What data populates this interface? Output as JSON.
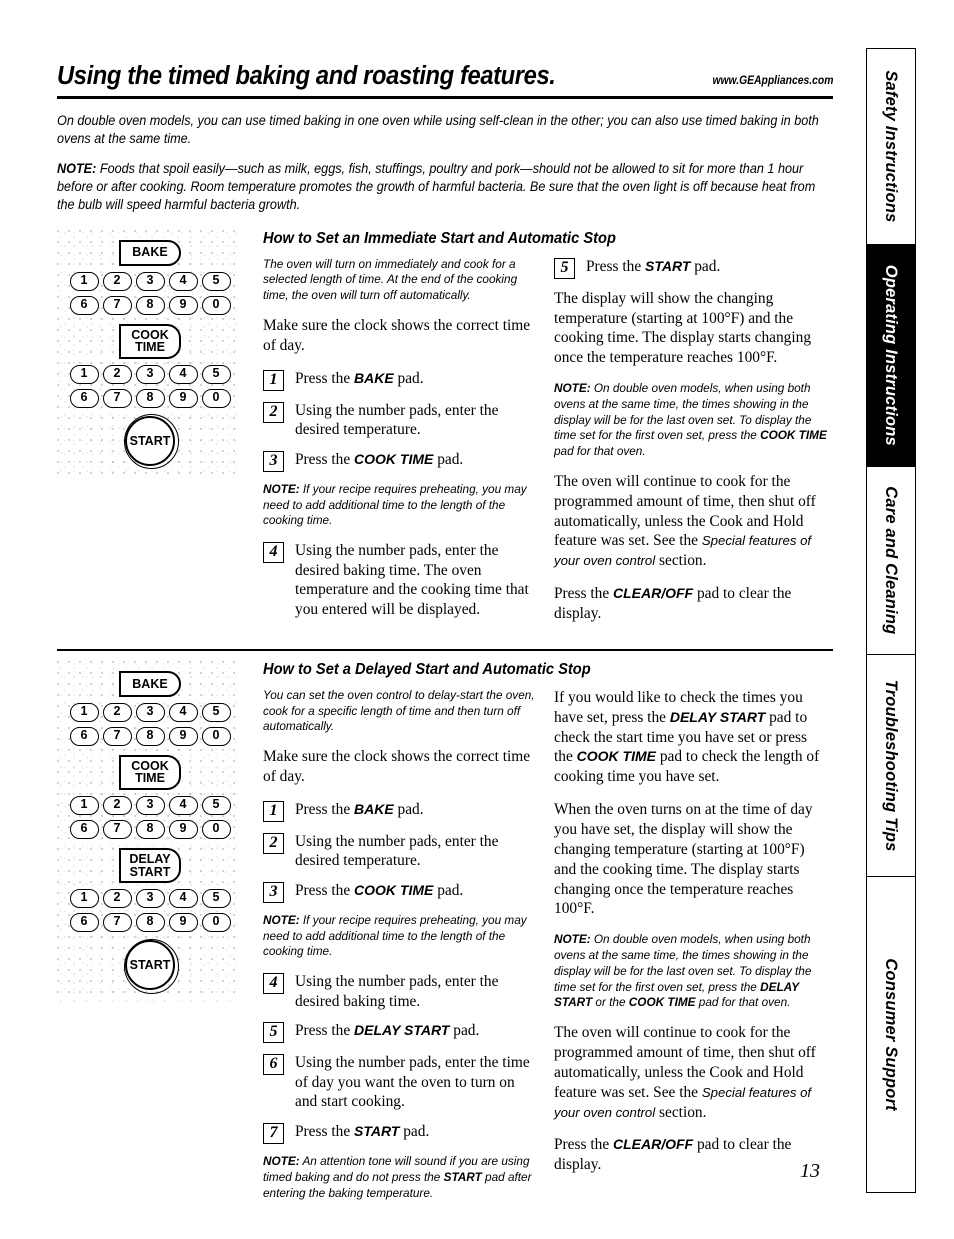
{
  "header": {
    "title": "Using the timed baking and roasting features.",
    "url": "www.GEAppliances.com"
  },
  "intro": {
    "paragraph": "On double oven models, you can use timed baking in one oven while using self-clean in the other; you can also use timed baking in both ovens at the same time.",
    "note_label": "NOTE:",
    "note_text": " Foods that spoil easily—such as milk, eggs, fish, stuffings, poultry and pork—should not be allowed to sit for more than 1 hour before or after cooking. Room temperature promotes the growth of harmful bacteria. Be sure that the oven light is off because heat from the bulb will speed harmful bacteria growth."
  },
  "sections": [
    {
      "heading": "How to Set an Immediate Start and Automatic Stop",
      "diagram": {
        "pads": [
          "BAKE",
          "COOK TIME",
          "START"
        ],
        "numbers_top": [
          "1",
          "2",
          "3",
          "4",
          "5"
        ],
        "numbers_bottom": [
          "6",
          "7",
          "8",
          "9",
          "0"
        ]
      },
      "left": {
        "intro_italic": "The oven will turn on immediately and cook for a selected length of time. At the end of the cooking time, the oven will turn off automatically.",
        "clock_text": "Make sure the clock shows the correct time of day.",
        "step1_num": "1",
        "step1_pre": "Press the ",
        "step1_bold": "BAKE",
        "step1_post": " pad.",
        "step2_num": "2",
        "step2_text": "Using the number pads, enter the desired temperature.",
        "step3_num": "3",
        "step3_pre": "Press the ",
        "step3_bold": "COOK TIME",
        "step3_post": " pad.",
        "note_label": "NOTE:",
        "note_text": " If your recipe requires preheating, you may need to add additional time to the length of the cooking time.",
        "step4_num": "4",
        "step4_text": "Using the number pads, enter the desired baking time. The oven temperature and the cooking time that you entered will be displayed."
      },
      "right": {
        "step5_num": "5",
        "step5_pre": "Press the ",
        "step5_bold": "START",
        "step5_post": " pad.",
        "display_text": "The display will show the changing temperature (starting at 100°F) and the cooking time. The display starts changing once the temperature reaches 100°F.",
        "note_label": "NOTE:",
        "note_pre": " On double oven models, when using both ovens at the same time, the times showing in the display will be for the last oven set. To display the time set for the first oven set, press the ",
        "note_bold": "COOK TIME",
        "note_post": " pad for that oven.",
        "continue_pre": "The oven will continue to cook for the programmed amount of time, then shut off automatically, unless the Cook and Hold feature was set. See the ",
        "continue_italic": "Special features of your oven control",
        "continue_post": " section.",
        "clear_pre": "Press the ",
        "clear_bold": "CLEAR/OFF",
        "clear_post": " pad to clear the display."
      }
    },
    {
      "heading": "How to Set a Delayed Start and Automatic Stop",
      "diagram": {
        "pads": [
          "BAKE",
          "COOK TIME",
          "DELAY START",
          "START"
        ],
        "numbers_top": [
          "1",
          "2",
          "3",
          "4",
          "5"
        ],
        "numbers_bottom": [
          "6",
          "7",
          "8",
          "9",
          "0"
        ]
      },
      "left": {
        "intro_italic": "You can set the oven control to delay-start the oven, cook for a specific length of time and then turn off automatically.",
        "clock_text": "Make sure the clock shows the correct time of day.",
        "step1_num": "1",
        "step1_pre": "Press the ",
        "step1_bold": "BAKE",
        "step1_post": " pad.",
        "step2_num": "2",
        "step2_text": "Using the number pads, enter the desired temperature.",
        "step3_num": "3",
        "step3_pre": "Press the ",
        "step3_bold": "COOK TIME",
        "step3_post": " pad.",
        "note_label": "NOTE:",
        "note_text": " If your recipe requires preheating, you may need to add additional time to the length of the cooking time.",
        "step4_num": "4",
        "step4_text": "Using the number pads, enter the desired baking time.",
        "step5_num": "5",
        "step5_pre": "Press the ",
        "step5_bold": "DELAY START",
        "step5_post": " pad.",
        "step6_num": "6",
        "step6_text": "Using the number pads, enter the time of day you want the oven to turn on and start cooking.",
        "step7_num": "7",
        "step7_pre": "Press the ",
        "step7_bold": "START",
        "step7_post": " pad.",
        "note2_label": "NOTE:",
        "note2_pre": " An attention tone will sound if you are using timed baking and do not press the ",
        "note2_bold": "START",
        "note2_post": " pad after entering the baking temperature."
      },
      "right": {
        "check_pre": "If you would like to check the times you have set, press the ",
        "check_bold1": "DELAY START",
        "check_mid": " pad to check the start time you have set or press the ",
        "check_bold2": "COOK TIME",
        "check_post": " pad to check the length of cooking time you have set.",
        "turnon_text": "When the oven turns on at the time of day you have set, the display will show the changing temperature (starting at 100°F) and the cooking time. The display starts changing once the temperature reaches 100°F.",
        "note_label": "NOTE:",
        "note_pre": " On double oven models, when using both ovens at the same time, the times showing in the display will be for the last oven set. To display the time set for the first oven set, press the ",
        "note_bold1": "DELAY START",
        "note_mid": " or the ",
        "note_bold2": "COOK TIME",
        "note_post": " pad for that oven.",
        "continue_pre": "The oven will continue to cook for the programmed amount of time, then shut off automatically, unless the Cook and Hold feature was set. See the ",
        "continue_italic": "Special features of your oven control",
        "continue_post": " section.",
        "clear_pre": "Press the ",
        "clear_bold": "CLEAR/OFF",
        "clear_post": " pad to clear the display."
      }
    }
  ],
  "sidebar": {
    "tabs": [
      {
        "label": "Safety Instructions",
        "active": false
      },
      {
        "label": "Operating Instructions",
        "active": true
      },
      {
        "label": "Care and Cleaning",
        "active": false
      },
      {
        "label": "Troubleshooting Tips",
        "active": false
      },
      {
        "label": "Consumer Support",
        "active": false
      }
    ]
  },
  "footer": {
    "page_number": "13"
  }
}
